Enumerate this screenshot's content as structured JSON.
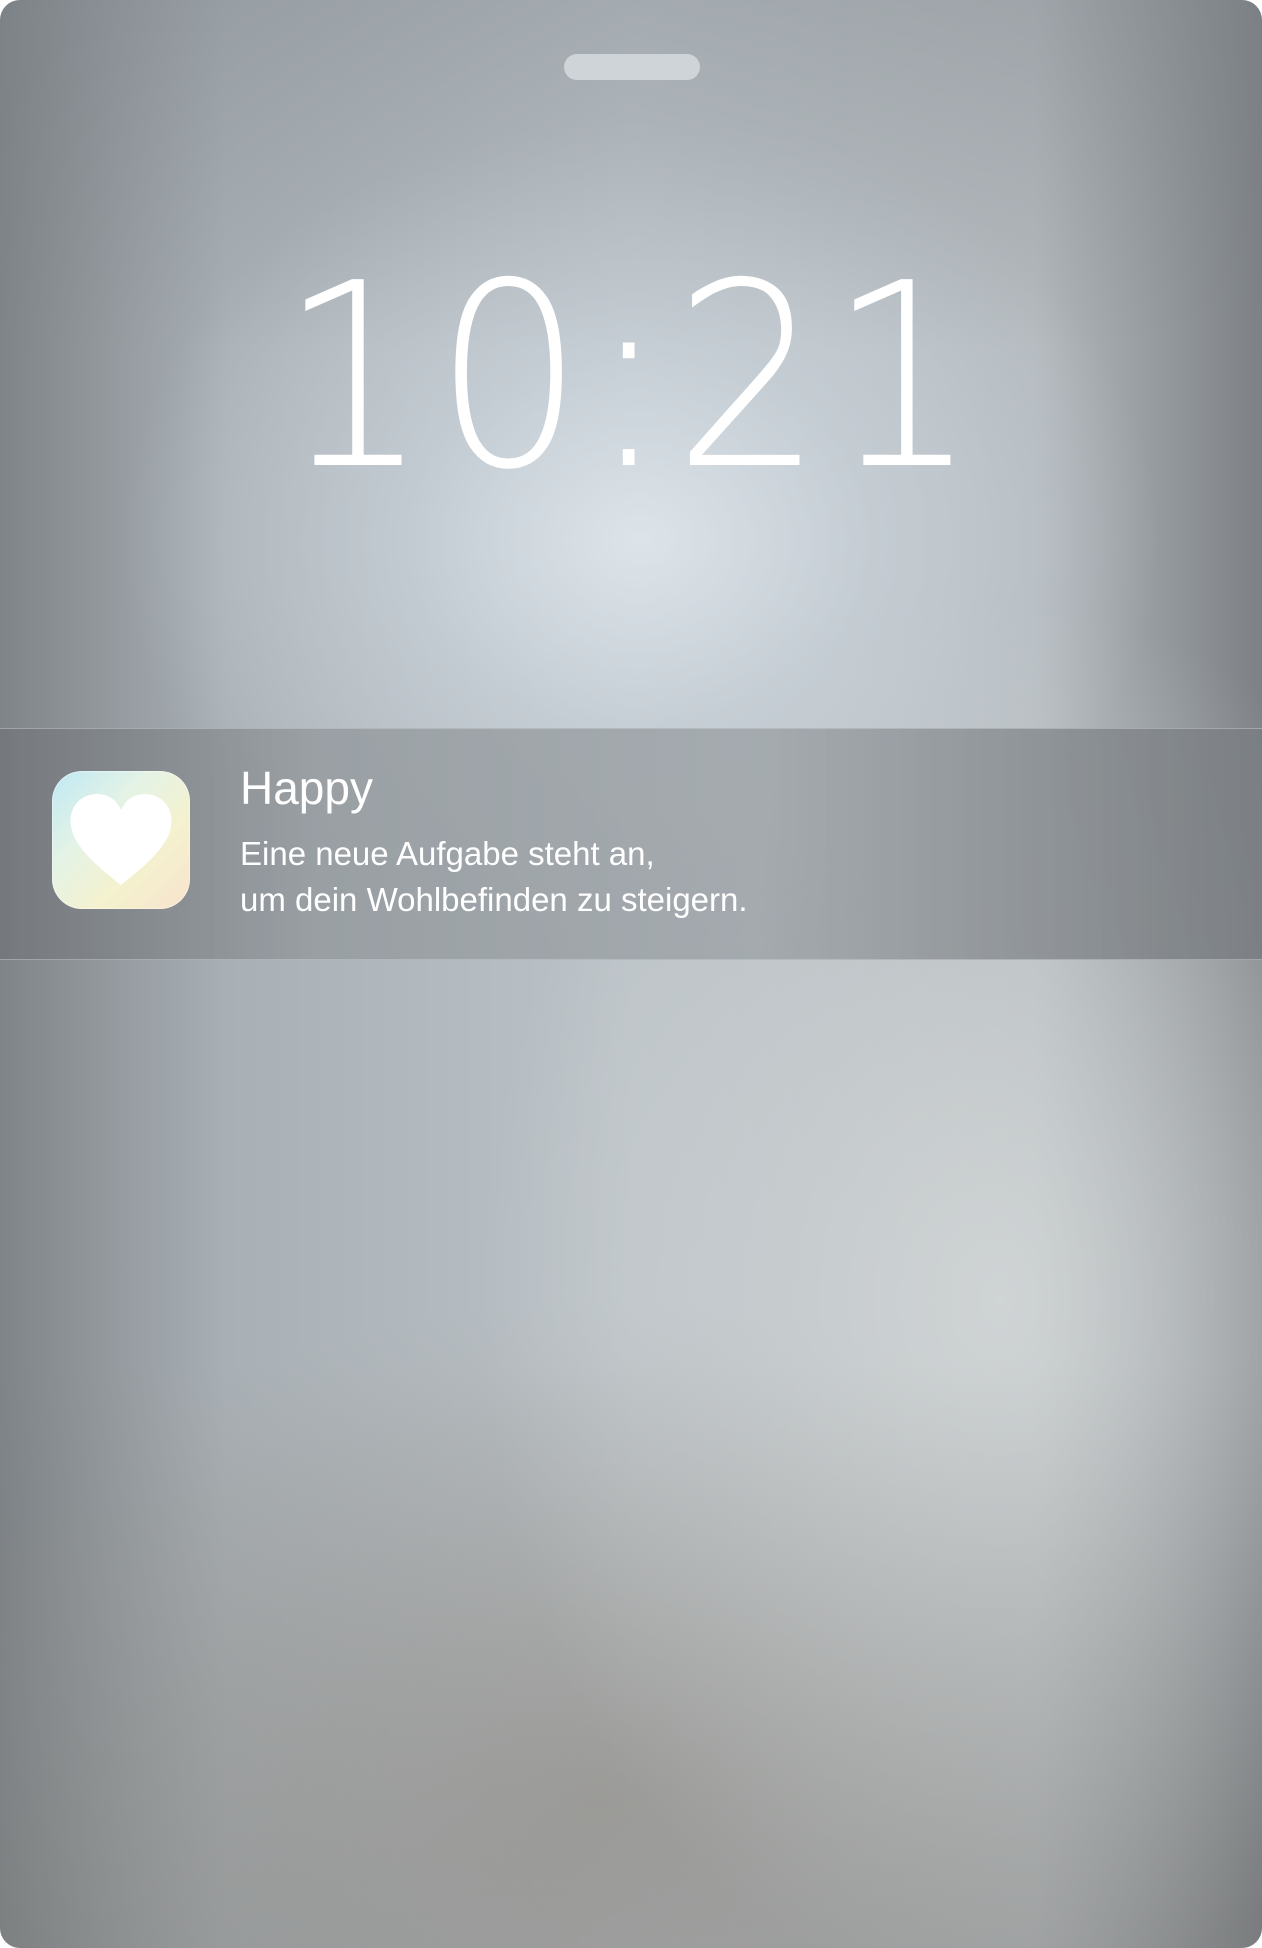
{
  "lockscreen": {
    "time": "10:21"
  },
  "notification": {
    "app_name": "Happy",
    "app_icon": "heart-icon",
    "message_lines": [
      "Eine neue Aufgabe steht an,",
      "um dein Wohlbefinden zu steigern."
    ]
  },
  "colors": {
    "text": "#ffffff",
    "banner": "#9aa0a4",
    "icon_gradient_start": "#bfe8f4",
    "icon_gradient_end": "#f8e3cc"
  }
}
